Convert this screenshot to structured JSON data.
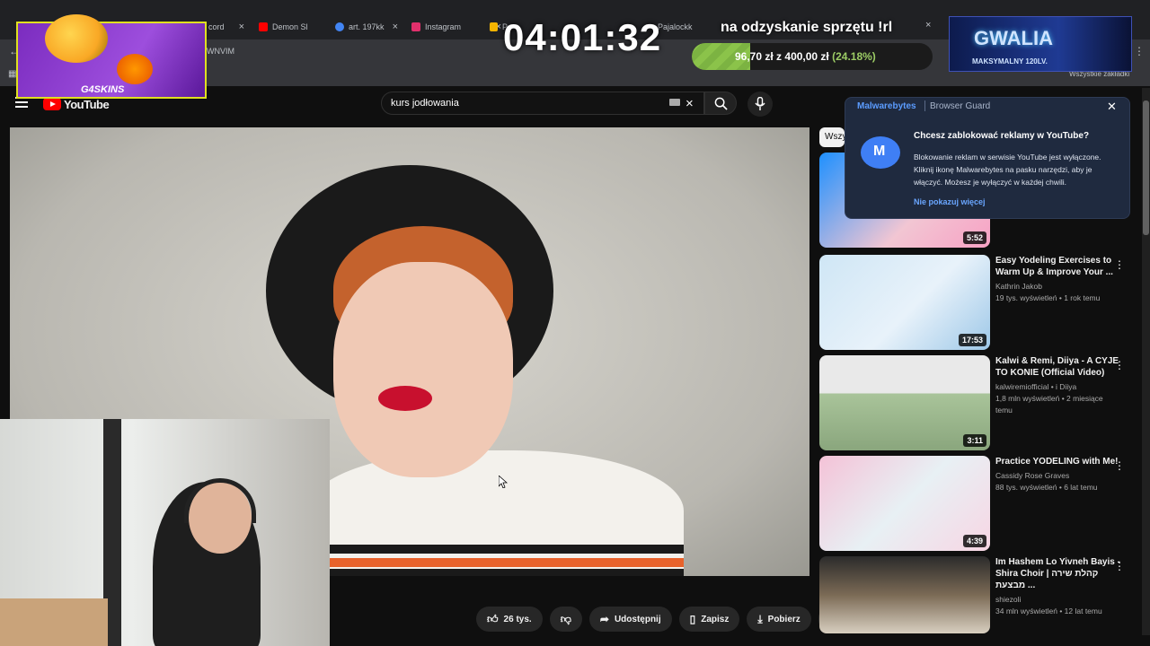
{
  "browser": {
    "tabs": [
      {
        "label": "cord",
        "color": "#5865f2"
      },
      {
        "label": "Demon Sl",
        "color": "#ff0000"
      },
      {
        "label": "art. 197kk",
        "color": "#4285f4"
      },
      {
        "label": "Instagram",
        "color": "#e1306c"
      },
      {
        "label": "P",
        "color": "#f4b400"
      },
      {
        "label": "Pajalockk",
        "color": "#9146ff"
      }
    ],
    "address_fragment": "WNVIM",
    "bookmarks_label": "Wszystkie zakładki"
  },
  "overlay": {
    "timer": "04:01:32",
    "goal_title": "na odzyskanie sprzętu !rl",
    "goal_current": "96,70 zł",
    "goal_separator": "z",
    "goal_target": "400,00 zł",
    "goal_percent_label": "(24.18%)",
    "goal_fraction": 0.2418,
    "sponsor_logo": "G4SKINS",
    "server_title": "GWALIA",
    "server_subtitle": "MAKSYMALNY 120LV."
  },
  "youtube": {
    "logo_text": "YouTube",
    "search_value": "kurs jodłowania",
    "chip_label": "Wszy",
    "actions": {
      "likes": "26 tys.",
      "share": "Udostępnij",
      "save": "Zapisz",
      "download": "Pobierz"
    },
    "recommendations": [
      {
        "title": "",
        "channel": "",
        "stats": "",
        "duration": "5:52",
        "thumb": "#f2c6d3"
      },
      {
        "title": "Easy Yodeling Exercises to Warm Up & Improve Your ...",
        "channel": "Kathrin Jakob",
        "stats": "19 tys. wyświetleń • 1 rok temu",
        "duration": "17:53",
        "thumb": "#cfe6f5"
      },
      {
        "title": "Kalwi & Remi, Diiya - A CYJE TO KONIE (Official Video)",
        "channel": "kalwiremiofficial • i Diiya",
        "stats": "1,8 mln wyświetleń • 2 miesiące temu",
        "duration": "3:11",
        "thumb": "#a9c49a"
      },
      {
        "title": "Practice YODELING with Me!",
        "channel": "Cassidy Rose Graves",
        "stats": "88 tys. wyświetleń • 6 lat temu",
        "duration": "4:39",
        "thumb": "#f4c2d7"
      },
      {
        "title": "Im Hashem Lo Yivneh Bayis - Shira Choir | קהלת שירה מבצעת ...",
        "channel": "shiezoli",
        "stats": "34 mln wyświetleń • 12 lat temu",
        "duration": "",
        "thumb": "#7b6a55"
      }
    ]
  },
  "malwarebytes": {
    "brand": "Malwarebytes",
    "product": "Browser Guard",
    "heading": "Chcesz zablokować reklamy w YouTube?",
    "body": "Blokowanie reklam w serwisie YouTube jest wyłączone. Kliknij ikonę Malwarebytes na pasku narzędzi, aby je włączyć. Możesz je wyłączyć w każdej chwili.",
    "link": "Nie pokazuj więcej"
  }
}
